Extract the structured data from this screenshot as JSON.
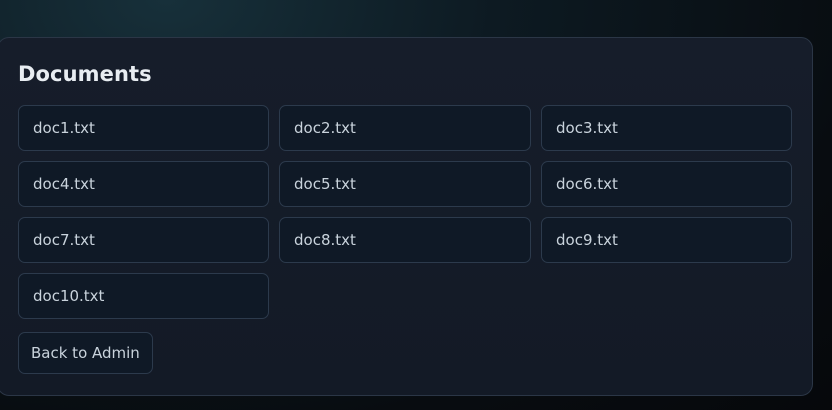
{
  "panel": {
    "title": "Documents",
    "documents": [
      "doc1.txt",
      "doc2.txt",
      "doc3.txt",
      "doc4.txt",
      "doc5.txt",
      "doc6.txt",
      "doc7.txt",
      "doc8.txt",
      "doc9.txt",
      "doc10.txt"
    ],
    "back_label": "Back to Admin"
  },
  "colors": {
    "panel_background": "#151c28",
    "tile_background": "#0f1926",
    "tile_border": "#2c3a4c",
    "text": "#c9d3dc"
  }
}
